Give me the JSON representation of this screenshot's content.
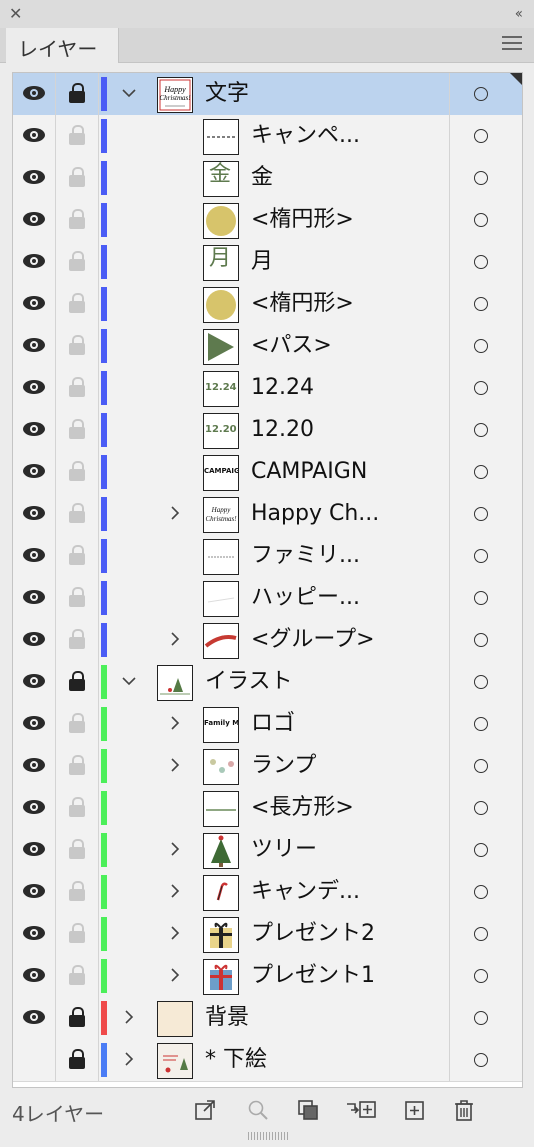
{
  "panel": {
    "close_glyph": "✕",
    "collapse_glyph": "‹‹",
    "tab_label": "レイヤー",
    "footer_count": "4レイヤー"
  },
  "colors": {
    "selected_row": "#bcd3ee",
    "layer_text_color": "#4a5cf5",
    "layer_illust_color": "#4cef5a",
    "layer_bg_color": "#ef4a4a",
    "layer_sketch_color": "#4a7cf5"
  },
  "rows": [
    {
      "name": "文字",
      "level": 0,
      "visible": true,
      "locked": true,
      "color": "#4a5cf5",
      "expander": "open",
      "thumb": "card",
      "selected": true
    },
    {
      "name": "キャンペ...",
      "level": 2,
      "visible": true,
      "locked": false,
      "color": "#4a5cf5",
      "expander": "none",
      "thumb": "dash"
    },
    {
      "name": "金",
      "level": 2,
      "visible": true,
      "locked": false,
      "color": "#4a5cf5",
      "expander": "none",
      "thumb": "kanji-kin"
    },
    {
      "name": "<楕円形>",
      "level": 2,
      "visible": true,
      "locked": false,
      "color": "#4a5cf5",
      "expander": "none",
      "thumb": "gold-circle"
    },
    {
      "name": "月",
      "level": 2,
      "visible": true,
      "locked": false,
      "color": "#4a5cf5",
      "expander": "none",
      "thumb": "kanji-tsuki"
    },
    {
      "name": "<楕円形>",
      "level": 2,
      "visible": true,
      "locked": false,
      "color": "#4a5cf5",
      "expander": "none",
      "thumb": "gold-circle"
    },
    {
      "name": "<パス>",
      "level": 2,
      "visible": true,
      "locked": false,
      "color": "#4a5cf5",
      "expander": "none",
      "thumb": "triangle"
    },
    {
      "name": "12.24",
      "level": 2,
      "visible": true,
      "locked": false,
      "color": "#4a5cf5",
      "expander": "none",
      "thumb": "date-1224"
    },
    {
      "name": "12.20",
      "level": 2,
      "visible": true,
      "locked": false,
      "color": "#4a5cf5",
      "expander": "none",
      "thumb": "date-1220"
    },
    {
      "name": "CAMPAIGN",
      "level": 2,
      "visible": true,
      "locked": false,
      "color": "#4a5cf5",
      "expander": "none",
      "thumb": "campaign"
    },
    {
      "name": "Happy Ch...",
      "level": 1,
      "visible": true,
      "locked": false,
      "color": "#4a5cf5",
      "expander": "closed",
      "thumb": "script"
    },
    {
      "name": "ファミリ...",
      "level": 2,
      "visible": true,
      "locked": false,
      "color": "#4a5cf5",
      "expander": "none",
      "thumb": "small-text"
    },
    {
      "name": "ハッピー...",
      "level": 2,
      "visible": true,
      "locked": false,
      "color": "#4a5cf5",
      "expander": "none",
      "thumb": "faint-line"
    },
    {
      "name": "<グループ>",
      "level": 1,
      "visible": true,
      "locked": false,
      "color": "#4a5cf5",
      "expander": "closed",
      "thumb": "red-ribbon"
    },
    {
      "name": "イラスト",
      "level": 0,
      "visible": true,
      "locked": true,
      "color": "#4cef5a",
      "expander": "open",
      "thumb": "illust"
    },
    {
      "name": "ロゴ",
      "level": 1,
      "visible": true,
      "locked": false,
      "color": "#4cef5a",
      "expander": "closed",
      "thumb": "logo"
    },
    {
      "name": "ランプ",
      "level": 1,
      "visible": true,
      "locked": false,
      "color": "#4cef5a",
      "expander": "closed",
      "thumb": "lamps"
    },
    {
      "name": "<長方形>",
      "level": 2,
      "visible": true,
      "locked": false,
      "color": "#4cef5a",
      "expander": "none",
      "thumb": "rect"
    },
    {
      "name": "ツリー",
      "level": 1,
      "visible": true,
      "locked": false,
      "color": "#4cef5a",
      "expander": "closed",
      "thumb": "tree"
    },
    {
      "name": "キャンデ...",
      "level": 1,
      "visible": true,
      "locked": false,
      "color": "#4cef5a",
      "expander": "closed",
      "thumb": "candy"
    },
    {
      "name": "プレゼント2",
      "level": 1,
      "visible": true,
      "locked": false,
      "color": "#4cef5a",
      "expander": "closed",
      "thumb": "gift-yellow"
    },
    {
      "name": "プレゼント1",
      "level": 1,
      "visible": true,
      "locked": false,
      "color": "#4cef5a",
      "expander": "closed",
      "thumb": "gift-blue"
    },
    {
      "name": "背景",
      "level": 0,
      "visible": true,
      "locked": true,
      "color": "#ef4a4a",
      "expander": "closed",
      "thumb": "bg"
    },
    {
      "name": "* 下絵",
      "level": 0,
      "visible": false,
      "locked": true,
      "color": "#4a7cf5",
      "expander": "closed",
      "thumb": "sketch"
    }
  ],
  "thumb_text": {
    "kin": "金",
    "tsuki": "月",
    "d1224": "12.24",
    "d1220": "12.20",
    "campaign": "CAMPAIGN",
    "happy": "Happy Christmas!",
    "logo": "Family Mall"
  },
  "footer_icons": [
    "export-icon",
    "search-icon",
    "mask-icon",
    "move-to-layer-icon",
    "new-sublayer-icon",
    "trash-icon"
  ]
}
